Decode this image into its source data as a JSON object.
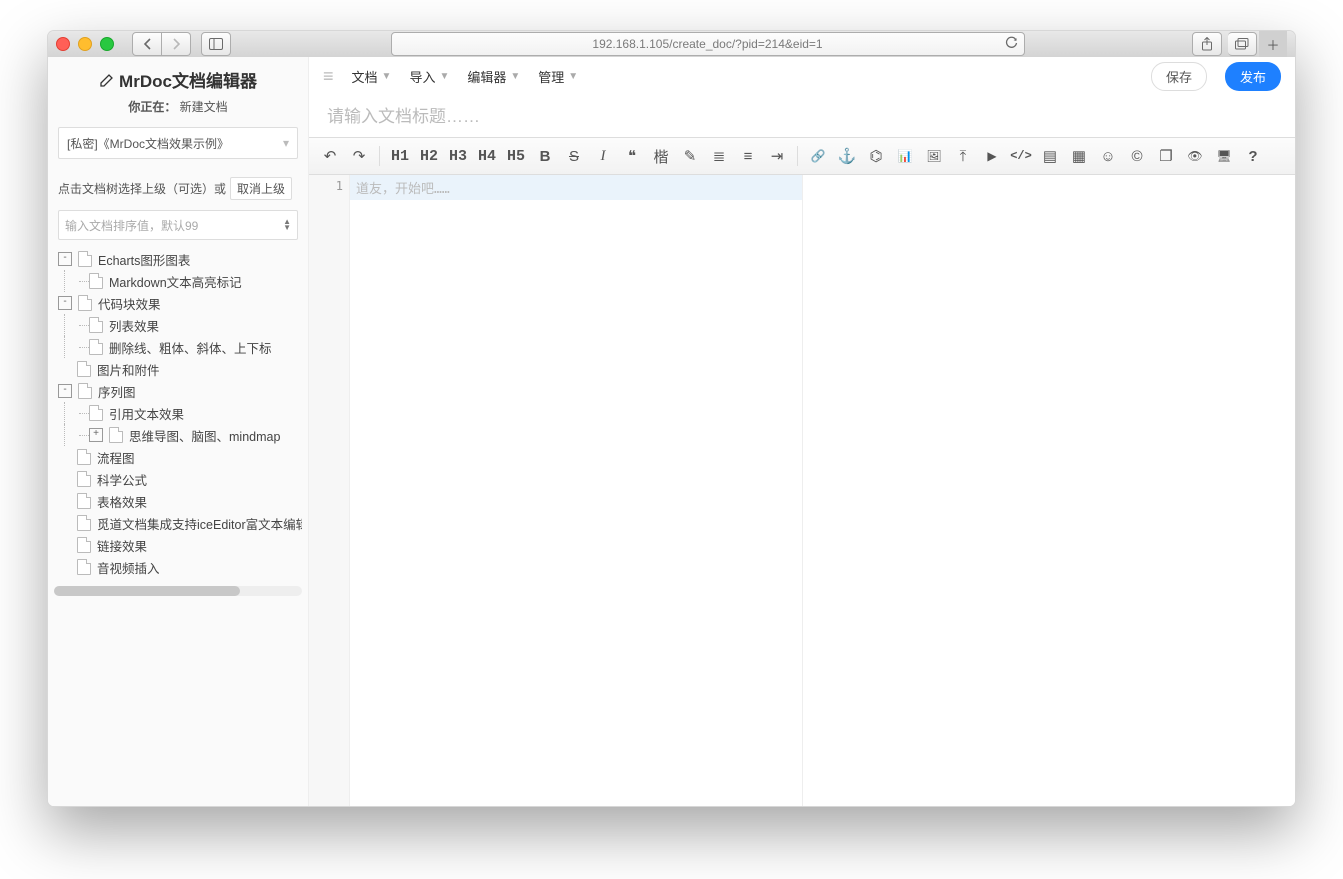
{
  "browser": {
    "url": "192.168.1.105/create_doc/?pid=214&eid=1"
  },
  "sidebar": {
    "title": "MrDoc文档编辑器",
    "subtitle_prefix": "你正在：",
    "subtitle_mode": "新建文档",
    "project_option": "[私密]《MrDoc文档效果示例》",
    "parent_hint": "点击文档树选择上级（可选）或",
    "cancel_parent": "取消上级",
    "sort_placeholder": "输入文档排序值，默认99",
    "tree": [
      {
        "depth": 0,
        "expand": "-",
        "label": "Echarts图形图表"
      },
      {
        "depth": 1,
        "expand": "",
        "label": "Markdown文本高亮标记"
      },
      {
        "depth": 0,
        "expand": "-",
        "label": "代码块效果"
      },
      {
        "depth": 1,
        "expand": "",
        "label": "列表效果"
      },
      {
        "depth": 1,
        "expand": "",
        "label": "删除线、粗体、斜体、上下标"
      },
      {
        "depth": 0,
        "expand": "",
        "label": "图片和附件"
      },
      {
        "depth": 0,
        "expand": "-",
        "label": "序列图"
      },
      {
        "depth": 1,
        "expand": "",
        "label": "引用文本效果"
      },
      {
        "depth": 1,
        "expand": "+",
        "label": "思维导图、脑图、mindmap"
      },
      {
        "depth": 0,
        "expand": "",
        "label": "流程图"
      },
      {
        "depth": 0,
        "expand": "",
        "label": "科学公式"
      },
      {
        "depth": 0,
        "expand": "",
        "label": "表格效果"
      },
      {
        "depth": 0,
        "expand": "",
        "label": "觅道文档集成支持iceEditor富文本编辑！"
      },
      {
        "depth": 0,
        "expand": "",
        "label": "链接效果"
      },
      {
        "depth": 0,
        "expand": "",
        "label": "音视频插入"
      }
    ]
  },
  "menubar": {
    "items": [
      "文档",
      "导入",
      "编辑器",
      "管理"
    ],
    "save": "保存",
    "publish": "发布"
  },
  "doc": {
    "title_placeholder": "请输入文档标题……",
    "editor_placeholder": "道友，开始吧……",
    "line_no": "1"
  },
  "toolbar": {
    "undo": "↶",
    "redo": "↷",
    "h1": "H1",
    "h2": "H2",
    "h3": "H3",
    "h4": "H4",
    "h5": "H5",
    "bold": "B",
    "strike": "S",
    "italic": "I",
    "quote": "❝",
    "kai": "楷",
    "brush": "✎",
    "ul": "≣",
    "ol": "≡",
    "indent": "⇥",
    "link": "🔗",
    "anchor": "⚓",
    "sitemap": "⌬",
    "chart": "📊",
    "image": "🖼",
    "upload": "⤒",
    "video": "▶",
    "code": "</>",
    "codeblock": "▤",
    "table": "▦",
    "emoji": "☺",
    "copyright": "©",
    "window": "❐",
    "eye": "👁",
    "monitor": "🖥",
    "help": "?"
  }
}
